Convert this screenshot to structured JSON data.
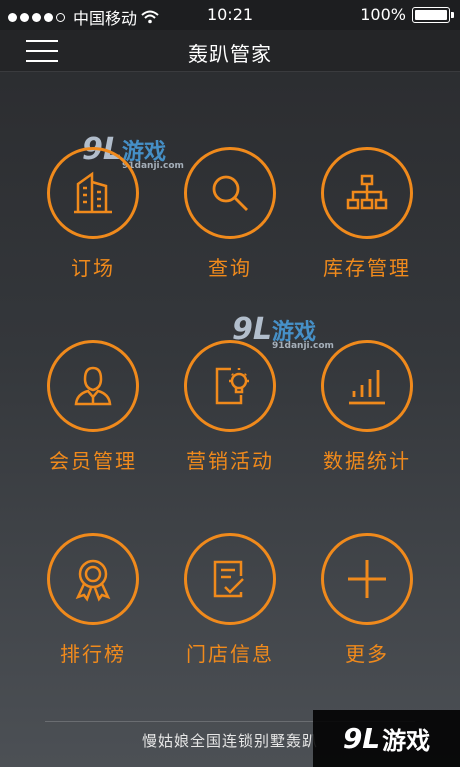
{
  "status_bar": {
    "carrier": "中国移动",
    "time": "10:21",
    "battery": "100%"
  },
  "nav": {
    "title": "轰趴管家"
  },
  "tiles": [
    {
      "label": "订场",
      "icon": "building-icon"
    },
    {
      "label": "查询",
      "icon": "search-icon"
    },
    {
      "label": "库存管理",
      "icon": "hierarchy-icon"
    },
    {
      "label": "会员管理",
      "icon": "user-icon"
    },
    {
      "label": "营销活动",
      "icon": "idea-document-icon"
    },
    {
      "label": "数据统计",
      "icon": "bar-chart-icon"
    },
    {
      "label": "排行榜",
      "icon": "medal-icon"
    },
    {
      "label": "门店信息",
      "icon": "edit-document-icon"
    },
    {
      "label": "更多",
      "icon": "plus-icon"
    }
  ],
  "watermark": {
    "logo_number": "9L",
    "logo_text": "游戏",
    "site": "91danji.com"
  },
  "footer": {
    "text": "慢姑娘全国连锁别墅轰趴"
  },
  "colors": {
    "accent": "#f08a1c",
    "background": "#2f3134"
  }
}
